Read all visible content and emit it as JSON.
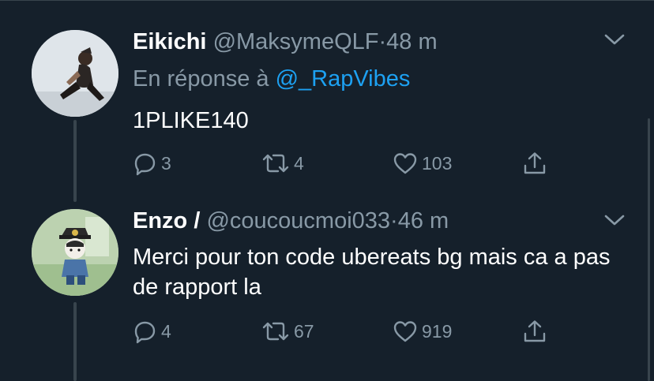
{
  "colors": {
    "background": "#15202b",
    "text": "#ffffff",
    "secondary_text": "#8899a6",
    "link": "#1da1f2",
    "divider": "#38444d"
  },
  "tweets": [
    {
      "display_name": "Eikichi",
      "handle": "@MaksymeQLF",
      "separator": "·",
      "time": "48 m",
      "reply_prefix": "En réponse à",
      "reply_mention": "@_RapVibes",
      "body": "1PLIKE140",
      "icons": {
        "avatar": "profile-photo",
        "menu": "chevron-down-icon",
        "reply": "comment-icon",
        "retweet": "retweet-icon",
        "like": "heart-icon",
        "share": "share-icon"
      },
      "counts": {
        "replies": "3",
        "retweets": "4",
        "likes": "103"
      }
    },
    {
      "display_name": "Enzo /",
      "handle": "@coucoucmoi033",
      "separator": "·",
      "time": "46 m",
      "body": "Merci pour ton code ubereats bg mais ca a pas de rapport la",
      "icons": {
        "avatar": "profile-photo",
        "menu": "chevron-down-icon",
        "reply": "comment-icon",
        "retweet": "retweet-icon",
        "like": "heart-icon",
        "share": "share-icon"
      },
      "counts": {
        "replies": "4",
        "retweets": "67",
        "likes": "919"
      }
    }
  ]
}
